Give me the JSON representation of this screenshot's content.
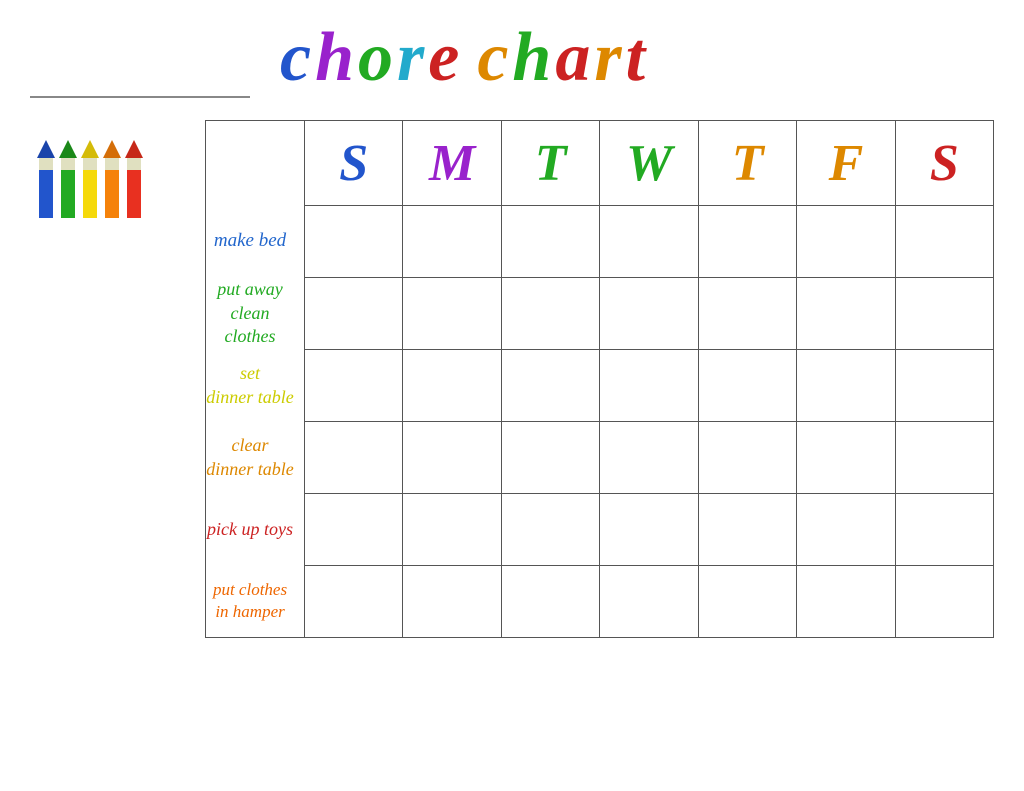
{
  "header": {
    "title_word1": "chore",
    "title_word2": "chart",
    "name_line_placeholder": ""
  },
  "days": {
    "headers": [
      "S",
      "M",
      "T",
      "W",
      "T",
      "F",
      "S"
    ],
    "colors": [
      "#2255cc",
      "#9922cc",
      "#22aa22",
      "#22aa22",
      "#dd8800",
      "#dd8800",
      "#cc2222"
    ]
  },
  "chores": [
    {
      "label": "make bed",
      "color": "#2266cc",
      "multiline": false
    },
    {
      "label": "put away\nclean clothes",
      "color": "#22aa22",
      "multiline": true
    },
    {
      "label": "set\ndinner table",
      "color": "#cccc00",
      "multiline": true
    },
    {
      "label": "clear\ndinner table",
      "color": "#dd8800",
      "multiline": true
    },
    {
      "label": "pick up toys",
      "color": "#cc2222",
      "multiline": false
    },
    {
      "label": "put clothes\nin hamper",
      "color": "#ee6600",
      "multiline": true
    }
  ],
  "crayons": [
    {
      "color": "#2255cc",
      "tip_color": "#1a44aa"
    },
    {
      "color": "#22aa22",
      "tip_color": "#1a8818"
    },
    {
      "color": "#f5d90a",
      "tip_color": "#d4bb08"
    },
    {
      "color": "#f5820a",
      "tip_color": "#d46e08"
    },
    {
      "color": "#e83020",
      "tip_color": "#c62818"
    }
  ]
}
